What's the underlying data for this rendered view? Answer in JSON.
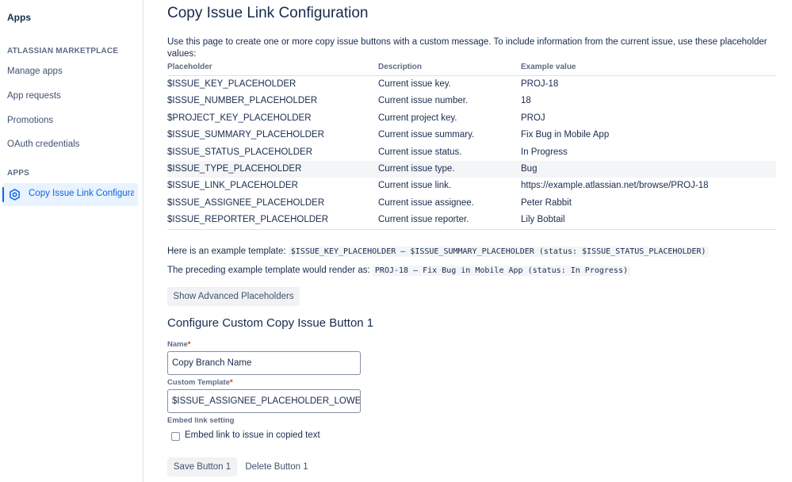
{
  "sidebar": {
    "title": "Apps",
    "marketplace_heading": "ATLASSIAN MARKETPLACE",
    "items": [
      {
        "label": "Manage apps"
      },
      {
        "label": "App requests"
      },
      {
        "label": "Promotions"
      },
      {
        "label": "OAuth credentials"
      }
    ],
    "apps_heading": "APPS",
    "active_item": {
      "label": "Copy Issue Link Configuration",
      "icon": "gear-icon"
    }
  },
  "main": {
    "title": "Copy Issue Link Configuration",
    "intro": "Use this page to create one or more copy issue buttons with a custom message. To include information from the current issue, use these placeholder values:",
    "table": {
      "headers": [
        "Placeholder",
        "Description",
        "Example value"
      ],
      "rows": [
        [
          "$ISSUE_KEY_PLACEHOLDER",
          "Current issue key.",
          "PROJ-18"
        ],
        [
          "$ISSUE_NUMBER_PLACEHOLDER",
          "Current issue number.",
          "18"
        ],
        [
          "$PROJECT_KEY_PLACEHOLDER",
          "Current project key.",
          "PROJ"
        ],
        [
          "$ISSUE_SUMMARY_PLACEHOLDER",
          "Current issue summary.",
          "Fix Bug in Mobile App"
        ],
        [
          "$ISSUE_STATUS_PLACEHOLDER",
          "Current issue status.",
          "In Progress"
        ],
        [
          "$ISSUE_TYPE_PLACEHOLDER",
          "Current issue type.",
          "Bug"
        ],
        [
          "$ISSUE_LINK_PLACEHOLDER",
          "Current issue link.",
          "https://example.atlassian.net/browse/PROJ-18"
        ],
        [
          "$ISSUE_ASSIGNEE_PLACEHOLDER",
          "Current issue assignee.",
          "Peter Rabbit"
        ],
        [
          "$ISSUE_REPORTER_PLACEHOLDER",
          "Current issue reporter.",
          "Lily Bobtail"
        ]
      ]
    },
    "example_template_label": "Here is an example template:",
    "example_template_code": "$ISSUE_KEY_PLACEHOLDER – $ISSUE_SUMMARY_PLACEHOLDER (status: $ISSUE_STATUS_PLACEHOLDER)",
    "rendered_label": "The preceding example template would render as:",
    "rendered_code": "PROJ-18 – Fix Bug in Mobile App (status: In Progress)",
    "advanced_button": "Show Advanced Placeholders",
    "configure_title": "Configure Custom Copy Issue Button 1",
    "form": {
      "name_label": "Name",
      "name_value": "Copy Branch Name",
      "template_label": "Custom Template",
      "template_value": "$ISSUE_ASSIGNEE_PLACEHOLDER_LOWERCASE",
      "required_marker": "*",
      "embed_heading": "Embed link setting",
      "embed_checkbox_label": "Embed link to issue in copied text",
      "embed_checked": false
    },
    "save_button": "Save Button 1",
    "delete_button": "Delete Button 1"
  },
  "colors": {
    "accent": "#0c66e4",
    "text": "#172b4d",
    "required": "#de350b",
    "highlight_row": "#f4f5f7"
  }
}
